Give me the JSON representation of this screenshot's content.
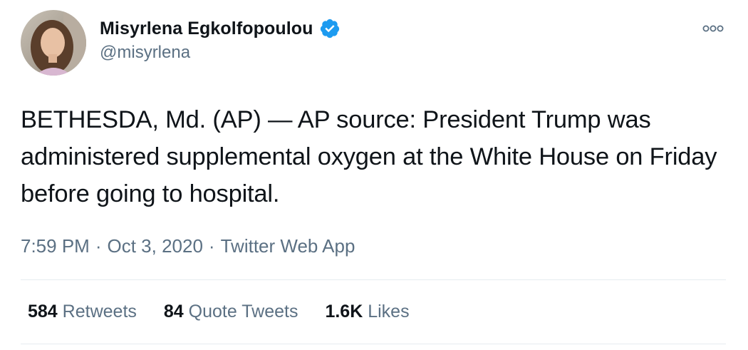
{
  "author": {
    "display_name": "Misyrlena Egkolfopoulou",
    "handle": "@misyrlena",
    "verified": true,
    "avatar_icon": "profile-photo"
  },
  "more_icon": "more-options-icon",
  "tweet": {
    "text": "BETHESDA, Md. (AP) — AP source: President Trump was administered supplemental oxygen at the White House on Friday before going to hospital."
  },
  "meta": {
    "time": "7:59 PM",
    "separator": "·",
    "date": "Oct 3, 2020",
    "source": "Twitter Web App"
  },
  "stats": {
    "retweets": {
      "count": "584",
      "label": "Retweets"
    },
    "quote_tweets": {
      "count": "84",
      "label": "Quote Tweets"
    },
    "likes": {
      "count": "1.6K",
      "label": "Likes"
    }
  },
  "colors": {
    "text": "#0f1419",
    "secondary": "#5b7083",
    "verified": "#1d9bf0",
    "divider": "#e6ecf0"
  }
}
